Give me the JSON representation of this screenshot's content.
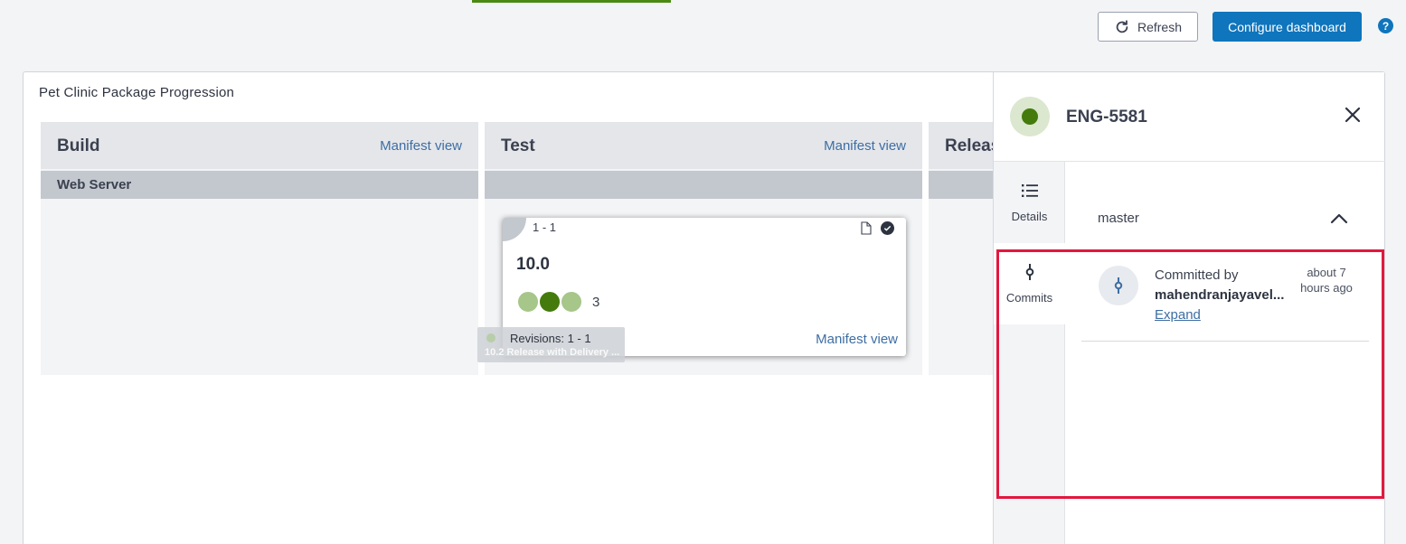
{
  "toolbar": {
    "refresh_label": "Refresh",
    "configure_label": "Configure dashboard",
    "help_glyph": "?"
  },
  "panel": {
    "title": "Pet Clinic Package Progression"
  },
  "stages": [
    {
      "name": "Build",
      "manifest_label": "Manifest view",
      "group_label": "Web Server"
    },
    {
      "name": "Test",
      "manifest_label": "Manifest view",
      "group_label": ""
    },
    {
      "name": "Releas",
      "manifest_label": "",
      "group_label": ""
    }
  ],
  "card": {
    "range": "1 - 1",
    "version": "10.0",
    "count": "3",
    "manifest_label": "Manifest view",
    "dots": [
      "light",
      "dark",
      "light"
    ]
  },
  "tooltip": {
    "revisions": "Revisions: 1 - 1",
    "subtitle": "10.2 Release with Delivery ..."
  },
  "drawer": {
    "title": "ENG-5581",
    "status_color": "#447b0c",
    "nav": [
      {
        "label": "Details",
        "icon": "list-icon"
      },
      {
        "label": "Commits",
        "icon": "commit-icon"
      }
    ],
    "branch": "master",
    "commit": {
      "committed_by": "Committed by",
      "author": "mahendranjayavel...",
      "expand_label": "Expand",
      "time": "about 7 hours ago"
    }
  },
  "colors": {
    "accent": "#0f75bc",
    "success": "#447b0c",
    "highlight": "#e3173e"
  }
}
